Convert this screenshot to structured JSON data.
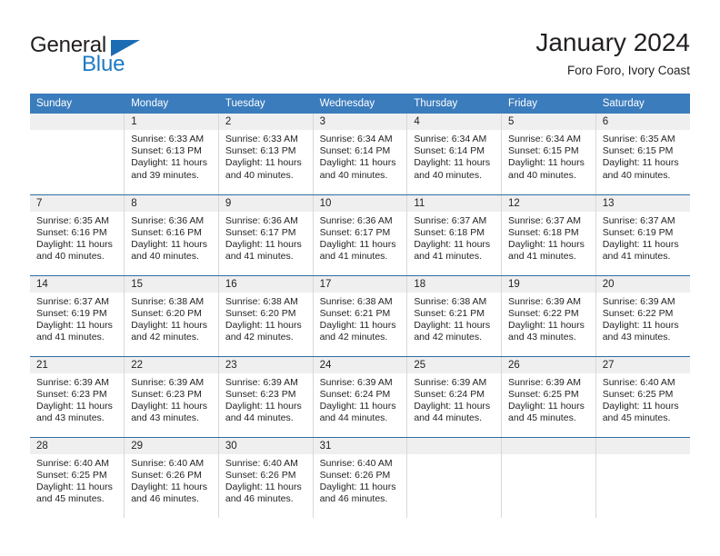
{
  "brand": {
    "name_top": "General",
    "name_bottom": "Blue",
    "triangle_color": "#1b6cb3",
    "blue_color": "#1f7ac4"
  },
  "header": {
    "title": "January 2024",
    "subtitle": "Foro Foro, Ivory Coast"
  },
  "theme": {
    "header_bg": "#3b7cbd",
    "daynum_bg": "#efefef",
    "row_separator": "#2e6da4",
    "cell_border": "#d8d8d8",
    "text": "#231f20"
  },
  "calendar": {
    "weekday_headers": [
      "Sunday",
      "Monday",
      "Tuesday",
      "Wednesday",
      "Thursday",
      "Friday",
      "Saturday"
    ],
    "weeks": [
      [
        {
          "day": "",
          "sunrise": "",
          "sunset": "",
          "daylight1": "",
          "daylight2": ""
        },
        {
          "day": "1",
          "sunrise": "Sunrise: 6:33 AM",
          "sunset": "Sunset: 6:13 PM",
          "daylight1": "Daylight: 11 hours",
          "daylight2": "and 39 minutes."
        },
        {
          "day": "2",
          "sunrise": "Sunrise: 6:33 AM",
          "sunset": "Sunset: 6:13 PM",
          "daylight1": "Daylight: 11 hours",
          "daylight2": "and 40 minutes."
        },
        {
          "day": "3",
          "sunrise": "Sunrise: 6:34 AM",
          "sunset": "Sunset: 6:14 PM",
          "daylight1": "Daylight: 11 hours",
          "daylight2": "and 40 minutes."
        },
        {
          "day": "4",
          "sunrise": "Sunrise: 6:34 AM",
          "sunset": "Sunset: 6:14 PM",
          "daylight1": "Daylight: 11 hours",
          "daylight2": "and 40 minutes."
        },
        {
          "day": "5",
          "sunrise": "Sunrise: 6:34 AM",
          "sunset": "Sunset: 6:15 PM",
          "daylight1": "Daylight: 11 hours",
          "daylight2": "and 40 minutes."
        },
        {
          "day": "6",
          "sunrise": "Sunrise: 6:35 AM",
          "sunset": "Sunset: 6:15 PM",
          "daylight1": "Daylight: 11 hours",
          "daylight2": "and 40 minutes."
        }
      ],
      [
        {
          "day": "7",
          "sunrise": "Sunrise: 6:35 AM",
          "sunset": "Sunset: 6:16 PM",
          "daylight1": "Daylight: 11 hours",
          "daylight2": "and 40 minutes."
        },
        {
          "day": "8",
          "sunrise": "Sunrise: 6:36 AM",
          "sunset": "Sunset: 6:16 PM",
          "daylight1": "Daylight: 11 hours",
          "daylight2": "and 40 minutes."
        },
        {
          "day": "9",
          "sunrise": "Sunrise: 6:36 AM",
          "sunset": "Sunset: 6:17 PM",
          "daylight1": "Daylight: 11 hours",
          "daylight2": "and 41 minutes."
        },
        {
          "day": "10",
          "sunrise": "Sunrise: 6:36 AM",
          "sunset": "Sunset: 6:17 PM",
          "daylight1": "Daylight: 11 hours",
          "daylight2": "and 41 minutes."
        },
        {
          "day": "11",
          "sunrise": "Sunrise: 6:37 AM",
          "sunset": "Sunset: 6:18 PM",
          "daylight1": "Daylight: 11 hours",
          "daylight2": "and 41 minutes."
        },
        {
          "day": "12",
          "sunrise": "Sunrise: 6:37 AM",
          "sunset": "Sunset: 6:18 PM",
          "daylight1": "Daylight: 11 hours",
          "daylight2": "and 41 minutes."
        },
        {
          "day": "13",
          "sunrise": "Sunrise: 6:37 AM",
          "sunset": "Sunset: 6:19 PM",
          "daylight1": "Daylight: 11 hours",
          "daylight2": "and 41 minutes."
        }
      ],
      [
        {
          "day": "14",
          "sunrise": "Sunrise: 6:37 AM",
          "sunset": "Sunset: 6:19 PM",
          "daylight1": "Daylight: 11 hours",
          "daylight2": "and 41 minutes."
        },
        {
          "day": "15",
          "sunrise": "Sunrise: 6:38 AM",
          "sunset": "Sunset: 6:20 PM",
          "daylight1": "Daylight: 11 hours",
          "daylight2": "and 42 minutes."
        },
        {
          "day": "16",
          "sunrise": "Sunrise: 6:38 AM",
          "sunset": "Sunset: 6:20 PM",
          "daylight1": "Daylight: 11 hours",
          "daylight2": "and 42 minutes."
        },
        {
          "day": "17",
          "sunrise": "Sunrise: 6:38 AM",
          "sunset": "Sunset: 6:21 PM",
          "daylight1": "Daylight: 11 hours",
          "daylight2": "and 42 minutes."
        },
        {
          "day": "18",
          "sunrise": "Sunrise: 6:38 AM",
          "sunset": "Sunset: 6:21 PM",
          "daylight1": "Daylight: 11 hours",
          "daylight2": "and 42 minutes."
        },
        {
          "day": "19",
          "sunrise": "Sunrise: 6:39 AM",
          "sunset": "Sunset: 6:22 PM",
          "daylight1": "Daylight: 11 hours",
          "daylight2": "and 43 minutes."
        },
        {
          "day": "20",
          "sunrise": "Sunrise: 6:39 AM",
          "sunset": "Sunset: 6:22 PM",
          "daylight1": "Daylight: 11 hours",
          "daylight2": "and 43 minutes."
        }
      ],
      [
        {
          "day": "21",
          "sunrise": "Sunrise: 6:39 AM",
          "sunset": "Sunset: 6:23 PM",
          "daylight1": "Daylight: 11 hours",
          "daylight2": "and 43 minutes."
        },
        {
          "day": "22",
          "sunrise": "Sunrise: 6:39 AM",
          "sunset": "Sunset: 6:23 PM",
          "daylight1": "Daylight: 11 hours",
          "daylight2": "and 43 minutes."
        },
        {
          "day": "23",
          "sunrise": "Sunrise: 6:39 AM",
          "sunset": "Sunset: 6:23 PM",
          "daylight1": "Daylight: 11 hours",
          "daylight2": "and 44 minutes."
        },
        {
          "day": "24",
          "sunrise": "Sunrise: 6:39 AM",
          "sunset": "Sunset: 6:24 PM",
          "daylight1": "Daylight: 11 hours",
          "daylight2": "and 44 minutes."
        },
        {
          "day": "25",
          "sunrise": "Sunrise: 6:39 AM",
          "sunset": "Sunset: 6:24 PM",
          "daylight1": "Daylight: 11 hours",
          "daylight2": "and 44 minutes."
        },
        {
          "day": "26",
          "sunrise": "Sunrise: 6:39 AM",
          "sunset": "Sunset: 6:25 PM",
          "daylight1": "Daylight: 11 hours",
          "daylight2": "and 45 minutes."
        },
        {
          "day": "27",
          "sunrise": "Sunrise: 6:40 AM",
          "sunset": "Sunset: 6:25 PM",
          "daylight1": "Daylight: 11 hours",
          "daylight2": "and 45 minutes."
        }
      ],
      [
        {
          "day": "28",
          "sunrise": "Sunrise: 6:40 AM",
          "sunset": "Sunset: 6:25 PM",
          "daylight1": "Daylight: 11 hours",
          "daylight2": "and 45 minutes."
        },
        {
          "day": "29",
          "sunrise": "Sunrise: 6:40 AM",
          "sunset": "Sunset: 6:26 PM",
          "daylight1": "Daylight: 11 hours",
          "daylight2": "and 46 minutes."
        },
        {
          "day": "30",
          "sunrise": "Sunrise: 6:40 AM",
          "sunset": "Sunset: 6:26 PM",
          "daylight1": "Daylight: 11 hours",
          "daylight2": "and 46 minutes."
        },
        {
          "day": "31",
          "sunrise": "Sunrise: 6:40 AM",
          "sunset": "Sunset: 6:26 PM",
          "daylight1": "Daylight: 11 hours",
          "daylight2": "and 46 minutes."
        },
        {
          "day": "",
          "sunrise": "",
          "sunset": "",
          "daylight1": "",
          "daylight2": ""
        },
        {
          "day": "",
          "sunrise": "",
          "sunset": "",
          "daylight1": "",
          "daylight2": ""
        },
        {
          "day": "",
          "sunrise": "",
          "sunset": "",
          "daylight1": "",
          "daylight2": ""
        }
      ]
    ]
  }
}
